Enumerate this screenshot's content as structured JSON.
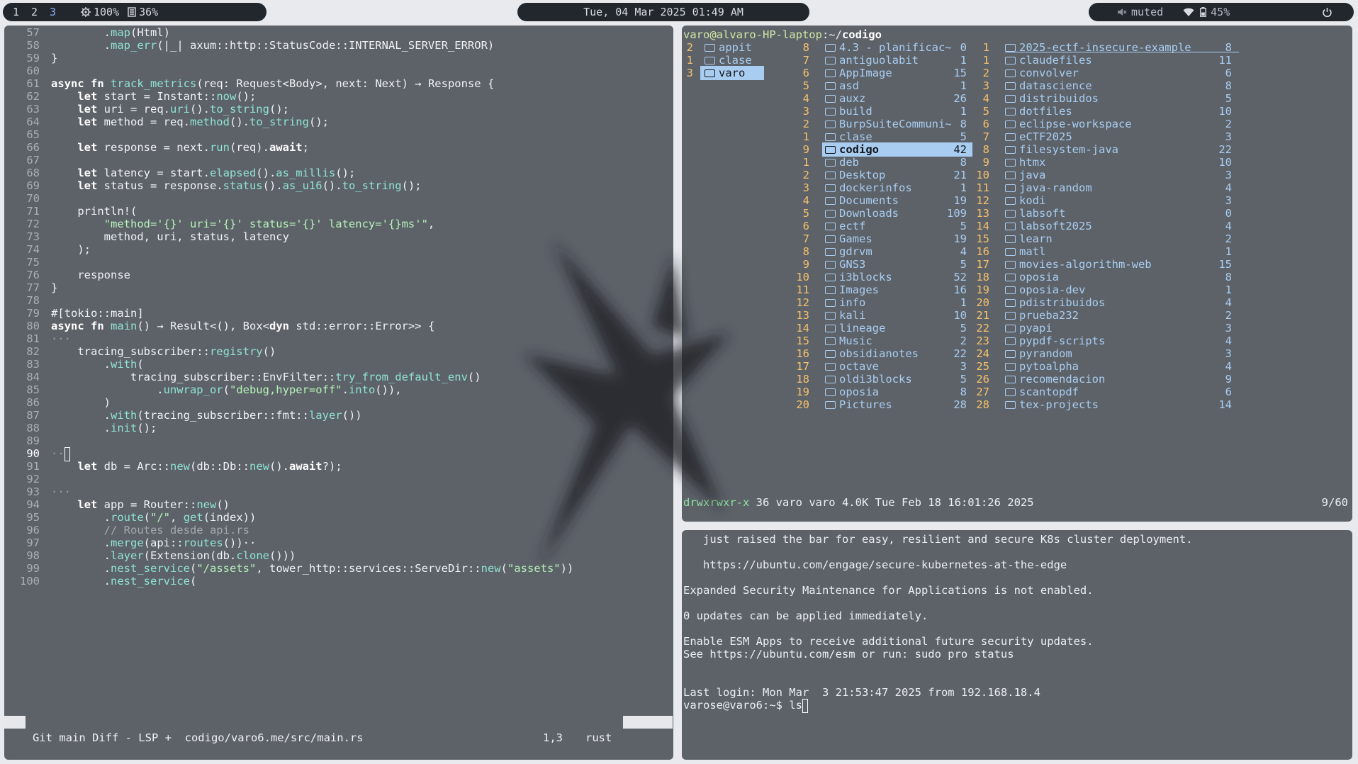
{
  "topbar": {
    "workspaces": [
      "1",
      "2",
      "3"
    ],
    "active_workspace": "3",
    "cpu": "100%",
    "memory": "36%",
    "clock": "Tue, 04 Mar 2025 01:49 AM",
    "volume": "muted",
    "battery": "45%",
    "icons": [
      "cpu-icon",
      "memory-icon",
      "mute-icon",
      "wifi-icon",
      "battery-icon",
      "power-icon"
    ]
  },
  "editor": {
    "lines": [
      {
        "n": "57",
        "t": "        .map(Html)"
      },
      {
        "n": "58",
        "t": "        .map_err(|_| axum::http::StatusCode::INTERNAL_SERVER_ERROR)"
      },
      {
        "n": "59",
        "t": "}"
      },
      {
        "n": "60",
        "t": ""
      },
      {
        "n": "61",
        "t": "async fn track_metrics(req: Request<Body>, next: Next) → Response {"
      },
      {
        "n": "62",
        "t": "    let start = Instant::now();"
      },
      {
        "n": "63",
        "t": "    let uri = req.uri().to_string();"
      },
      {
        "n": "64",
        "t": "    let method = req.method().to_string();"
      },
      {
        "n": "65",
        "t": ""
      },
      {
        "n": "66",
        "t": "    let response = next.run(req).await;"
      },
      {
        "n": "67",
        "t": ""
      },
      {
        "n": "68",
        "t": "    let latency = start.elapsed().as_millis();"
      },
      {
        "n": "69",
        "t": "    let status = response.status().as_u16().to_string();"
      },
      {
        "n": "70",
        "t": ""
      },
      {
        "n": "71",
        "t": "    println!("
      },
      {
        "n": "72",
        "t": "        \"method='{}' uri='{}' status='{}' latency='{}ms'\","
      },
      {
        "n": "73",
        "t": "        method, uri, status, latency"
      },
      {
        "n": "74",
        "t": "    );"
      },
      {
        "n": "75",
        "t": ""
      },
      {
        "n": "76",
        "t": "    response"
      },
      {
        "n": "77",
        "t": "}"
      },
      {
        "n": "78",
        "t": ""
      },
      {
        "n": "79",
        "t": "#[tokio::main]"
      },
      {
        "n": "80",
        "t": "async fn main() → Result<(), Box<dyn std::error::Error>> {"
      },
      {
        "n": "81",
        "t": "···"
      },
      {
        "n": "82",
        "t": "    tracing_subscriber::registry()"
      },
      {
        "n": "83",
        "t": "        .with("
      },
      {
        "n": "84",
        "t": "            tracing_subscriber::EnvFilter::try_from_default_env()"
      },
      {
        "n": "85",
        "t": "                .unwrap_or(\"debug,hyper=off\".into()),"
      },
      {
        "n": "86",
        "t": "        )"
      },
      {
        "n": "87",
        "t": "        .with(tracing_subscriber::fmt::layer())"
      },
      {
        "n": "88",
        "t": "        .init();"
      },
      {
        "n": "89",
        "t": ""
      },
      {
        "n": "90",
        "t": "··"
      },
      {
        "n": "91",
        "t": "    let db = Arc::new(db::Db::new().await?);"
      },
      {
        "n": "92",
        "t": ""
      },
      {
        "n": "93",
        "t": "···"
      },
      {
        "n": "94",
        "t": "    let app = Router::new()"
      },
      {
        "n": "95",
        "t": "        .route(\"/\", get(index))"
      },
      {
        "n": "96",
        "t": "        // Routes desde api.rs"
      },
      {
        "n": "97",
        "t": "        .merge(api::routes())··"
      },
      {
        "n": "98",
        "t": "        .layer(Extension(db.clone()))"
      },
      {
        "n": "99",
        "t": "        .nest_service(\"/assets\", tower_http::services::ServeDir::new(\"assets\"))"
      },
      {
        "n": "100",
        "t": "        .nest_service("
      }
    ],
    "current_line": "90",
    "status_left": "Git main Diff - LSP +  codigo/varo6.me/src/main.rs",
    "filetype": "rust",
    "position": "1,3"
  },
  "file_manager": {
    "path_user": "varo@alvaro-HP-laptop",
    "path_sep": ":~/",
    "path_dir": "codigo",
    "col1": [
      {
        "num": "2",
        "name": "appit"
      },
      {
        "num": "1",
        "name": "clase"
      },
      {
        "num": "3",
        "name": "varo",
        "selected": true
      }
    ],
    "col2": [
      {
        "num": "8",
        "name": "4.3 - planificac~",
        "count": "0"
      },
      {
        "num": "7",
        "name": "antiguolabit",
        "count": "1"
      },
      {
        "num": "6",
        "name": "AppImage",
        "count": "15"
      },
      {
        "num": "5",
        "name": "asd",
        "count": "1"
      },
      {
        "num": "4",
        "name": "auxz",
        "count": "26"
      },
      {
        "num": "3",
        "name": "build",
        "count": "1"
      },
      {
        "num": "2",
        "name": "BurpSuiteCommuni~",
        "count": "8"
      },
      {
        "num": "1",
        "name": "clase",
        "count": "5"
      },
      {
        "num": "9",
        "name": "codigo",
        "count": "42",
        "selected": true
      },
      {
        "num": "1",
        "name": "deb",
        "count": "8"
      },
      {
        "num": "2",
        "name": "Desktop",
        "count": "21"
      },
      {
        "num": "3",
        "name": "dockerinfos",
        "count": "1"
      },
      {
        "num": "4",
        "name": "Documents",
        "count": "19"
      },
      {
        "num": "5",
        "name": "Downloads",
        "count": "109"
      },
      {
        "num": "6",
        "name": "ectf",
        "count": "5"
      },
      {
        "num": "7",
        "name": "Games",
        "count": "19"
      },
      {
        "num": "8",
        "name": "gdrvm",
        "count": "4"
      },
      {
        "num": "9",
        "name": "GNS3",
        "count": "5"
      },
      {
        "num": "10",
        "name": "i3blocks",
        "count": "52"
      },
      {
        "num": "11",
        "name": "Images",
        "count": "16"
      },
      {
        "num": "12",
        "name": "info",
        "count": "1"
      },
      {
        "num": "13",
        "name": "kali",
        "count": "10"
      },
      {
        "num": "14",
        "name": "lineage",
        "count": "5"
      },
      {
        "num": "15",
        "name": "Music",
        "count": "2"
      },
      {
        "num": "16",
        "name": "obsidianotes",
        "count": "22"
      },
      {
        "num": "17",
        "name": "octave",
        "count": "3"
      },
      {
        "num": "18",
        "name": "oldi3blocks",
        "count": "5"
      },
      {
        "num": "19",
        "name": "oposia",
        "count": "8"
      },
      {
        "num": "20",
        "name": "Pictures",
        "count": "28"
      }
    ],
    "col3": [
      {
        "num": "1",
        "name": "2025-ectf-insecure-example",
        "count": "8"
      },
      {
        "num": "1",
        "name": "claudefiles",
        "count": "11"
      },
      {
        "num": "2",
        "name": "convolver",
        "count": "6"
      },
      {
        "num": "3",
        "name": "datascience",
        "count": "8"
      },
      {
        "num": "4",
        "name": "distribuidos",
        "count": "5"
      },
      {
        "num": "5",
        "name": "dotfiles",
        "count": "10"
      },
      {
        "num": "6",
        "name": "eclipse-workspace",
        "count": "2"
      },
      {
        "num": "7",
        "name": "eCTF2025",
        "count": "3"
      },
      {
        "num": "8",
        "name": "filesystem-java",
        "count": "22"
      },
      {
        "num": "9",
        "name": "htmx",
        "count": "10"
      },
      {
        "num": "10",
        "name": "java",
        "count": "3"
      },
      {
        "num": "11",
        "name": "java-random",
        "count": "4"
      },
      {
        "num": "12",
        "name": "kodi",
        "count": "3"
      },
      {
        "num": "13",
        "name": "labsoft",
        "count": "0"
      },
      {
        "num": "14",
        "name": "labsoft2025",
        "count": "4"
      },
      {
        "num": "15",
        "name": "learn",
        "count": "2"
      },
      {
        "num": "16",
        "name": "matl",
        "count": "1"
      },
      {
        "num": "17",
        "name": "movies-algorithm-web",
        "count": "15"
      },
      {
        "num": "18",
        "name": "oposia",
        "count": "8"
      },
      {
        "num": "19",
        "name": "oposia-dev",
        "count": "1"
      },
      {
        "num": "20",
        "name": "pdistribuidos",
        "count": "4"
      },
      {
        "num": "21",
        "name": "prueba232",
        "count": "2"
      },
      {
        "num": "22",
        "name": "pyapi",
        "count": "3"
      },
      {
        "num": "23",
        "name": "pypdf-scripts",
        "count": "4"
      },
      {
        "num": "24",
        "name": "pyrandom",
        "count": "3"
      },
      {
        "num": "25",
        "name": "pytoalpha",
        "count": "4"
      },
      {
        "num": "26",
        "name": "recomendacion",
        "count": "9"
      },
      {
        "num": "27",
        "name": "scantopdf",
        "count": "6"
      },
      {
        "num": "28",
        "name": "tex-projects",
        "count": "14"
      }
    ],
    "status_perms": "drwxrwxr-x",
    "status_rest": " 36 varo varo 4.0K Tue Feb 18 16:01:26 2025",
    "status_pos": "9/60"
  },
  "terminal": {
    "lines": [
      "   just raised the bar for easy, resilient and secure K8s cluster deployment.",
      "",
      "   https://ubuntu.com/engage/secure-kubernetes-at-the-edge",
      "",
      "Expanded Security Maintenance for Applications is not enabled.",
      "",
      "0 updates can be applied immediately.",
      "",
      "Enable ESM Apps to receive additional future security updates.",
      "See https://ubuntu.com/esm or run: sudo pro status",
      "",
      "",
      "Last login: Mon Mar  3 21:53:47 2025 from 192.168.18.4"
    ],
    "prompt": "varose@varo6:~$ ",
    "command": "ls"
  },
  "colors": {
    "pane_bg": "#5d6269",
    "folder_blue": "#a9cdf0",
    "number_orange": "#f6c16a",
    "path_green": "#cfe8a3"
  }
}
